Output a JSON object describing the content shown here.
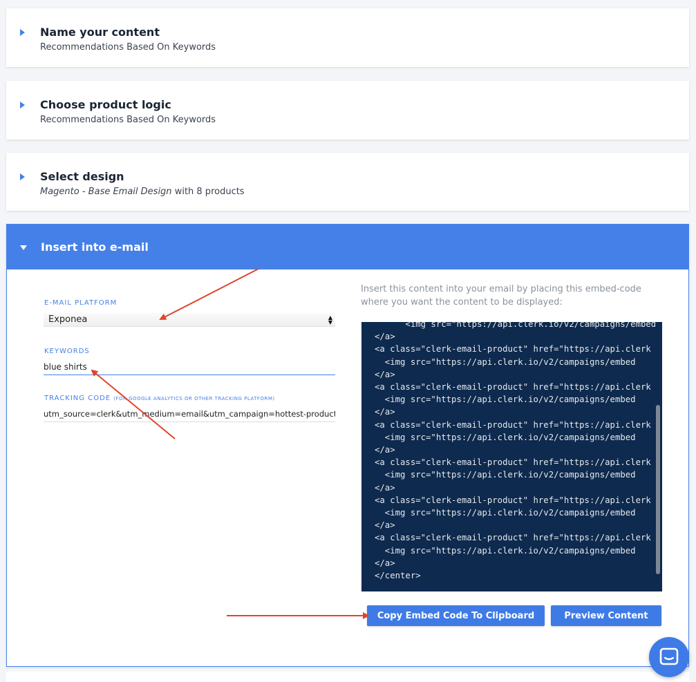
{
  "panels": [
    {
      "title": "Name your content",
      "subtitle": "Recommendations Based On Keywords"
    },
    {
      "title": "Choose product logic",
      "subtitle": "Recommendations Based On Keywords"
    },
    {
      "title": "Select design",
      "subtitle_italic": "Magento - Base Email Design",
      "subtitle_rest": " with 8 products"
    }
  ],
  "insert_panel": {
    "title": "Insert into e-mail",
    "email_platform": {
      "label": "E-MAIL PLATFORM",
      "selected": "Exponea"
    },
    "keywords": {
      "label": "KEYWORDS",
      "value": "blue shirts"
    },
    "tracking_code": {
      "label": "TRACKING CODE",
      "label_note": "(FOR GOOGLE ANALYTICS OR OTHER TRACKING PLATFORM)",
      "value": "utm_source=clerk&utm_medium=email&utm_campaign=hottest-product"
    },
    "embed_info": "Insert this content into your email by placing this embed-code where you want the content to be displayed:",
    "code": "      <img src=\"https://api.clerk.io/v2/campaigns/embed\n</a>\n<a class=\"clerk-email-product\" href=\"https://api.clerk\n  <img src=\"https://api.clerk.io/v2/campaigns/embed\n</a>\n<a class=\"clerk-email-product\" href=\"https://api.clerk\n  <img src=\"https://api.clerk.io/v2/campaigns/embed\n</a>\n<a class=\"clerk-email-product\" href=\"https://api.clerk\n  <img src=\"https://api.clerk.io/v2/campaigns/embed\n</a>\n<a class=\"clerk-email-product\" href=\"https://api.clerk\n  <img src=\"https://api.clerk.io/v2/campaigns/embed\n</a>\n<a class=\"clerk-email-product\" href=\"https://api.clerk\n  <img src=\"https://api.clerk.io/v2/campaigns/embed\n</a>\n<a class=\"clerk-email-product\" href=\"https://api.clerk\n  <img src=\"https://api.clerk.io/v2/campaigns/embed\n</a>\n</center>",
    "copy_button": "Copy Embed Code To Clipboard",
    "preview_button": "Preview Content"
  },
  "colors": {
    "accent": "#4580e8",
    "code_bg": "#0e2a4e",
    "annotation": "#e0442b"
  },
  "icons": {
    "chat": "chat-bubble-icon"
  }
}
